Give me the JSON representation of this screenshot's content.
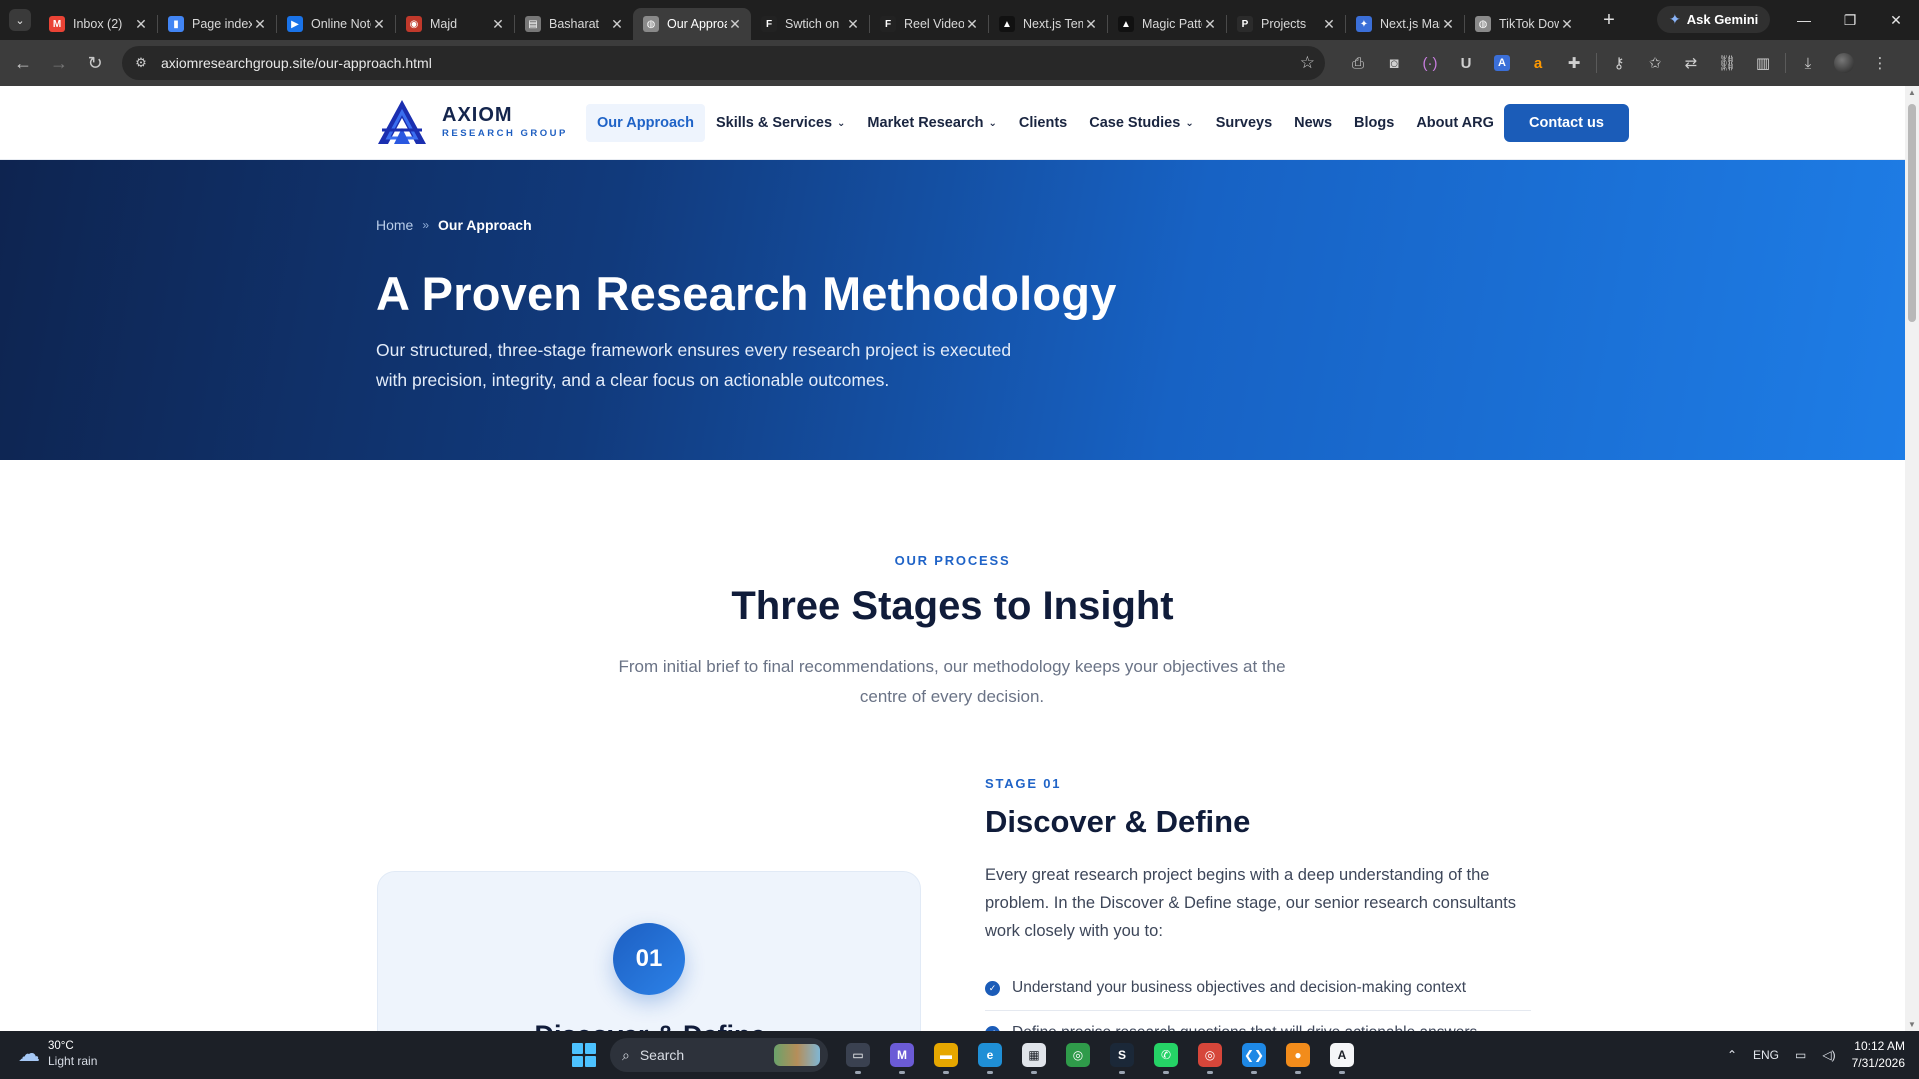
{
  "browser": {
    "tabs": [
      {
        "title": "Inbox (2)",
        "icon": "gmail-icon",
        "color": "#ea4335",
        "glyph": "M"
      },
      {
        "title": "Page indexing",
        "icon": "search-console-icon",
        "color": "#4285f4",
        "glyph": "▮"
      },
      {
        "title": "Online Notepad",
        "icon": "play-icon",
        "color": "#1a73e8",
        "glyph": "▶"
      },
      {
        "title": "Majd",
        "icon": "profile-icon",
        "color": "#c0392b",
        "glyph": "◉"
      },
      {
        "title": "Basharat",
        "icon": "document-icon",
        "color": "#777777",
        "glyph": "▤"
      },
      {
        "title": "Our Approach",
        "icon": "globe-icon",
        "color": "#8a8a8a",
        "glyph": "◍",
        "active": true
      },
      {
        "title": "Swtich on",
        "icon": "framer-icon",
        "color": "#222222",
        "glyph": "F"
      },
      {
        "title": "Reel Video",
        "icon": "framer-icon",
        "color": "#222222",
        "glyph": "F"
      },
      {
        "title": "Next.js Template",
        "icon": "vercel-icon",
        "color": "#111111",
        "glyph": "▲"
      },
      {
        "title": "Magic Patterns",
        "icon": "vercel-icon",
        "color": "#111111",
        "glyph": "▲"
      },
      {
        "title": "Projects",
        "icon": "projects-icon",
        "color": "#2b2b2b",
        "glyph": "P"
      },
      {
        "title": "Next.js Markup",
        "icon": "gemini-icon",
        "color": "#3b6fd8",
        "glyph": "✦"
      },
      {
        "title": "TikTok Downloader",
        "icon": "globe-icon",
        "color": "#8a8a8a",
        "glyph": "◍"
      }
    ],
    "ask_gemini": "Ask Gemini",
    "url": "axiomresearchgroup.site/our-approach.html"
  },
  "site": {
    "logo": {
      "name": "AXIOM",
      "sub": "RESEARCH GROUP"
    },
    "nav": [
      {
        "label": "Our Approach",
        "active": true,
        "dropdown": false
      },
      {
        "label": "Skills & Services",
        "dropdown": true
      },
      {
        "label": "Market Research",
        "dropdown": true
      },
      {
        "label": "Clients",
        "dropdown": false
      },
      {
        "label": "Case Studies",
        "dropdown": true
      },
      {
        "label": "Surveys",
        "dropdown": false
      },
      {
        "label": "News",
        "dropdown": false
      },
      {
        "label": "Blogs",
        "dropdown": false
      },
      {
        "label": "About ARG",
        "dropdown": false
      }
    ],
    "contact_label": "Contact us",
    "accent_color": "#1b5cb8"
  },
  "hero": {
    "breadcrumb": {
      "home": "Home",
      "sep": "»",
      "current": "Our Approach"
    },
    "title": "A Proven Research Methodology",
    "subtitle": "Our structured, three-stage framework ensures every research project is executed with precision, integrity, and a clear focus on actionable outcomes."
  },
  "process": {
    "eyebrow": "OUR PROCESS",
    "title": "Three Stages to Insight",
    "subtitle": "From initial brief to final recommendations, our methodology keeps your objectives at the centre of every decision.",
    "stage": {
      "number": "01",
      "card_title": "Discover & Define",
      "label": "STAGE 01",
      "title": "Discover & Define",
      "description": "Every great research project begins with a deep understanding of the problem. In the Discover & Define stage, our senior research consultants work closely with you to:",
      "points": [
        "Understand your business objectives and decision-making context",
        "Define precise research questions that will drive actionable answers"
      ]
    }
  },
  "taskbar": {
    "weather": {
      "temp": "30°C",
      "condition": "Light rain"
    },
    "search_placeholder": "Search",
    "apps": [
      {
        "name": "task-view-icon",
        "glyph": "▭",
        "color": "#3a4150"
      },
      {
        "name": "m365-icon",
        "glyph": "M",
        "color": "#6b5bd6"
      },
      {
        "name": "file-explorer-icon",
        "glyph": "▬",
        "color": "#e6a700"
      },
      {
        "name": "edge-icon",
        "glyph": "e",
        "color": "#1f8fd6"
      },
      {
        "name": "store-icon",
        "glyph": "▦",
        "color": "#e0e4ea"
      },
      {
        "name": "chrome-icon",
        "glyph": "◎",
        "color": "#2f9b4a",
        "focus": true
      },
      {
        "name": "steam-icon",
        "glyph": "S",
        "color": "#1b2838"
      },
      {
        "name": "whatsapp-icon",
        "glyph": "✆",
        "color": "#25d366"
      },
      {
        "name": "chrome-alt-icon",
        "glyph": "◎",
        "color": "#d6463a"
      },
      {
        "name": "vscode-icon",
        "glyph": "❮❯",
        "color": "#1e88e5"
      },
      {
        "name": "microphone-icon",
        "glyph": "●",
        "color": "#f28c1b"
      },
      {
        "name": "app-a-icon",
        "glyph": "A",
        "color": "#f5f6f8"
      }
    ],
    "language": "ENG",
    "time": "10:12 AM",
    "date": "7/31/2026"
  }
}
